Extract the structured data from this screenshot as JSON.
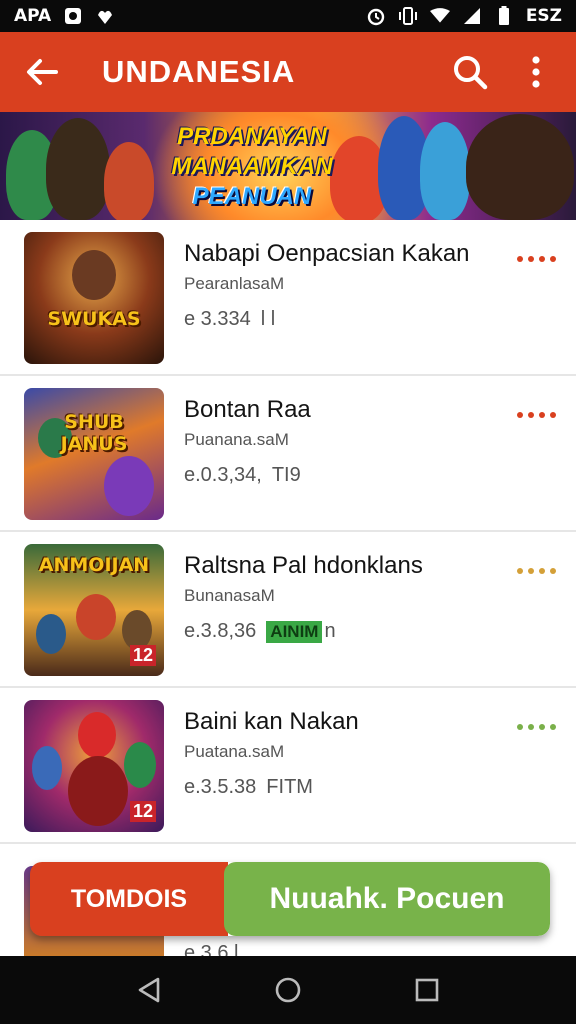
{
  "status_bar": {
    "left_text": "APA",
    "right_text": "ESZ",
    "icons": [
      "notification-square-icon",
      "app-leaf-icon",
      "alarm-icon",
      "vibrate-icon",
      "wifi-icon",
      "signal-icon",
      "battery-icon"
    ]
  },
  "app_bar": {
    "title": "UNDANESIA",
    "back_icon": "arrow-left-icon",
    "search_icon": "search-icon",
    "menu_icon": "more-vert-icon",
    "color": "#d9401f"
  },
  "banner": {
    "lines": [
      "PRDANAYAN",
      "MANAAMKAN",
      "PEANUAN"
    ]
  },
  "items": [
    {
      "name": "Nabapi Oenpacsian Kakan",
      "developer": "PearanlasaM",
      "price": "e 3.334",
      "extra": "l l",
      "thumb_label": "SWUKAS",
      "dots_color": "#d9401f",
      "badge": ""
    },
    {
      "name": "Bontan Raa",
      "developer": "Puanana.saM",
      "price": "e.0.3,34,",
      "extra": "TI9",
      "thumb_label": "SHUB JANUS",
      "dots_color": "#d9401f",
      "badge": ""
    },
    {
      "name": "Raltsna Pal hdonklans",
      "developer": "BunanasaM",
      "price": "e.3.8,36",
      "extra": "n",
      "thumb_label": "ANMOIJAN",
      "thumb_badge": "12",
      "dots_color": "#d4a038",
      "badge": "AINIM"
    },
    {
      "name": "Baini kan Nakan",
      "developer": "Puatana.saM",
      "price": "e.3.5.38",
      "extra": "FITM",
      "thumb_label": "",
      "thumb_badge": "12",
      "dots_color": "#7ab04a",
      "badge": ""
    }
  ],
  "partial_item": {
    "price": "e.3.6 l"
  },
  "cta": {
    "left_label": "TOMDOIS",
    "right_label": "Nuuahk. Pocuen"
  },
  "nav": {
    "back_icon": "nav-back-icon",
    "home_icon": "nav-home-icon",
    "recents_icon": "nav-recents-icon"
  }
}
